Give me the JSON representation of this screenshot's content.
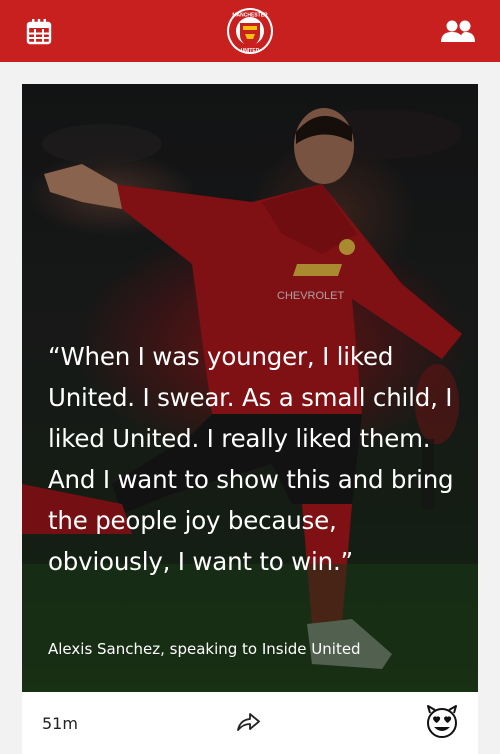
{
  "header": {
    "calendar_icon": "calendar-grid-icon",
    "logo_name": "manchester-united-crest",
    "logo_text_top": "MANCHESTER",
    "logo_text_bottom": "UNITED",
    "people_icon": "people-icon",
    "color": "#c7201f"
  },
  "card": {
    "quote": "“When I was younger, I liked United. I swear. As a small child, I liked United. I really liked them. And I want to show this and bring the people joy because, obviously, I want to win.”",
    "attribution": "Alexis Sanchez, speaking to Inside United",
    "shirt_sponsor": "CHEVROLET",
    "footer": {
      "time_ago": "51m",
      "share_icon": "share-arrow-icon",
      "reaction_icon": "devil-heart-eyes-emoji-icon"
    }
  }
}
